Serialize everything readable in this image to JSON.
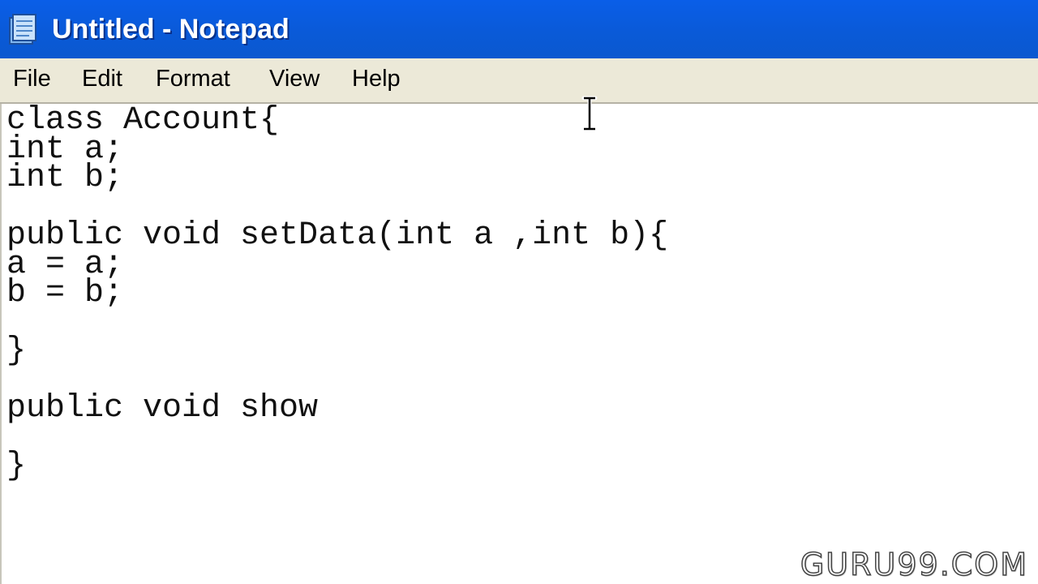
{
  "window": {
    "title": "Untitled - Notepad",
    "titlebar_color": "#0a5ee8",
    "app_icon": "notepad-icon"
  },
  "menu": {
    "items": [
      {
        "label": "File"
      },
      {
        "label": "Edit"
      },
      {
        "label": "Format"
      },
      {
        "label": "View"
      },
      {
        "label": "Help"
      }
    ]
  },
  "editor": {
    "lines": [
      "class Account{",
      "int a;",
      "int b;",
      "",
      "public void setData(int a ,int b){",
      "a = a;",
      "b = b;",
      "",
      "}",
      "",
      "public void show",
      "",
      "}"
    ]
  },
  "cursor": {
    "icon": "text-cursor-icon"
  },
  "watermark": {
    "text": "GURU99.COM"
  }
}
